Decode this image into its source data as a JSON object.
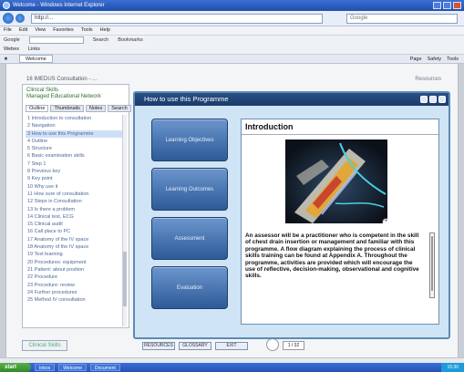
{
  "browser": {
    "window_title": "Welcome - Windows Internet Explorer",
    "address": "http://...",
    "search_placeholder": "Google",
    "menu": [
      "File",
      "Edit",
      "View",
      "Favorites",
      "Tools",
      "Help"
    ],
    "toolbar_links": [
      "Google",
      "Search",
      "Bookmarks"
    ],
    "links_bar": [
      "Webex",
      "Links"
    ],
    "tab_label": "Welcome",
    "tools": [
      "Page",
      "Safety",
      "Tools"
    ]
  },
  "page": {
    "crumb": "16 IMEDUS Consultation - ...",
    "crumb_right": "Resources",
    "left_panel": {
      "title_line1": "Clinical Skills",
      "title_line2": "Managed Educational Network",
      "tabs": [
        "Outline",
        "Thumbnails",
        "Notes",
        "Search"
      ],
      "items": [
        "1 Introduction to consultation",
        "2 Navigation",
        "3 How to use this Programme",
        "4 Outline",
        "5 Structure",
        "6 Basic examination skills",
        "7 Step 1",
        "8 Previous key",
        "9 Key point",
        "10 Why use it",
        "11 How sure of consultation",
        "12 Steps in Consultation",
        "13 Is there a problem",
        "14 Clinical test, ECG",
        "15 Clinical audit",
        "16 Call place to PC",
        "17 Anatomy of the IV space",
        "18 Anatomy of the IV space",
        "19 Test learning",
        "20 Procedures: equipment",
        "21 Patient: about position",
        "22 Procedure",
        "23 Procedure: review",
        "24 Further procedures",
        "25 Method IV consultation"
      ]
    },
    "logo_text": "Clinical Skills",
    "bottom_buttons": [
      "RESOURCES",
      "GLOSSARY",
      "EXIT"
    ],
    "pager": "1 / 32"
  },
  "modal": {
    "title": "How to use this Programme",
    "side_buttons": [
      "Learning Objectives",
      "Learning Outcomes",
      "Assessment",
      "Evaluation"
    ],
    "heading": "Introduction",
    "body": "An assessor will be a practitioner who is competent in the skill of chest drain insertion or management and familiar with this programme. A flow diagram explaining the process of clinical skills training can be found at Appendix A. Throughout the programme, activities are provided which will encourage the use of reflective, decision-making, observational and cognitive skills."
  },
  "taskbar": {
    "start": "start",
    "items": [
      "Inbox",
      "Welcome",
      "Document"
    ],
    "tray": "15:30"
  }
}
